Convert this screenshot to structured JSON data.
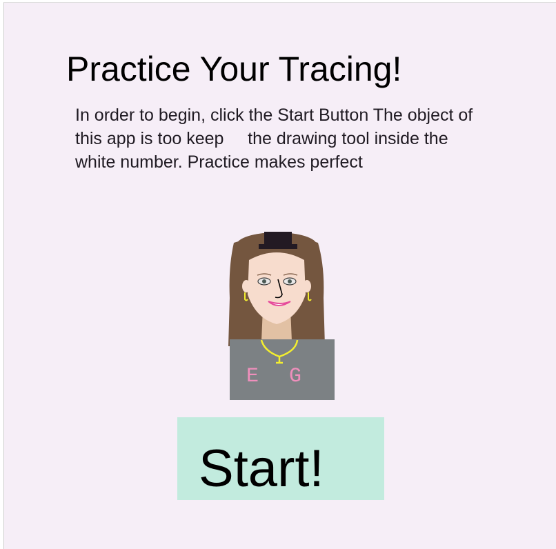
{
  "page": {
    "background": "#f6eef7"
  },
  "header": {
    "title": "Practice Your Tracing!"
  },
  "instructions": {
    "text": "In order to begin, click the Start Button The object of this app is too keep     the drawing tool inside the white number. Practice makes perfect"
  },
  "avatar": {
    "shirt_letters": [
      "E",
      "G"
    ],
    "colors": {
      "hair": "#74563f",
      "skin": "#f7dccd",
      "shirt": "#7c8184",
      "hat": "#231a23",
      "necklace": "#f3ee2f",
      "letters": "#ef8fbc"
    }
  },
  "start_button": {
    "label": "Start!",
    "color": "#c2ebde"
  }
}
